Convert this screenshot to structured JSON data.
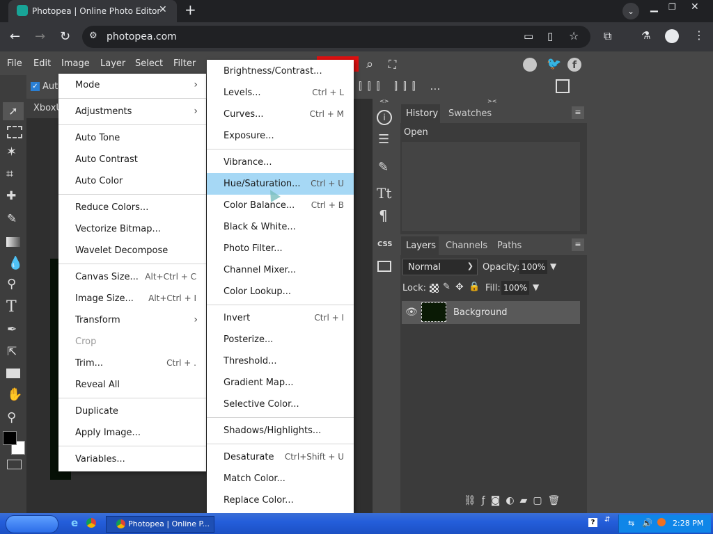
{
  "browser": {
    "tab_title": "Photopea | Online Photo Editor",
    "url": "photopea.com"
  },
  "menubar": [
    "File",
    "Edit",
    "Image",
    "Layer",
    "Select",
    "Filter"
  ],
  "options": {
    "auto_select_label": "Auto"
  },
  "document_tab": "XboxU",
  "image_menu": [
    {
      "label": "Mode",
      "submenu": true
    },
    {
      "sep": true
    },
    {
      "label": "Adjustments",
      "submenu": true
    },
    {
      "sep": true
    },
    {
      "label": "Auto Tone"
    },
    {
      "label": "Auto Contrast"
    },
    {
      "label": "Auto Color"
    },
    {
      "sep": true
    },
    {
      "label": "Reduce Colors..."
    },
    {
      "label": "Vectorize Bitmap..."
    },
    {
      "label": "Wavelet Decompose"
    },
    {
      "sep": true
    },
    {
      "label": "Canvas Size...",
      "shortcut": "Alt+Ctrl + C"
    },
    {
      "label": "Image Size...",
      "shortcut": "Alt+Ctrl + I"
    },
    {
      "label": "Transform",
      "submenu": true
    },
    {
      "label": "Crop",
      "disabled": true
    },
    {
      "label": "Trim...",
      "shortcut": "Ctrl + ."
    },
    {
      "label": "Reveal All"
    },
    {
      "sep": true
    },
    {
      "label": "Duplicate"
    },
    {
      "label": "Apply Image..."
    },
    {
      "sep": true
    },
    {
      "label": "Variables..."
    }
  ],
  "adjustments_menu": [
    {
      "label": "Brightness/Contrast..."
    },
    {
      "label": "Levels...",
      "shortcut": "Ctrl + L"
    },
    {
      "label": "Curves...",
      "shortcut": "Ctrl + M"
    },
    {
      "label": "Exposure..."
    },
    {
      "sep": true
    },
    {
      "label": "Vibrance..."
    },
    {
      "label": "Hue/Saturation...",
      "shortcut": "Ctrl + U",
      "highlighted": true
    },
    {
      "label": "Color Balance...",
      "shortcut": "Ctrl + B"
    },
    {
      "label": "Black & White..."
    },
    {
      "label": "Photo Filter..."
    },
    {
      "label": "Channel Mixer..."
    },
    {
      "label": "Color Lookup..."
    },
    {
      "sep": true
    },
    {
      "label": "Invert",
      "shortcut": "Ctrl + I"
    },
    {
      "label": "Posterize..."
    },
    {
      "label": "Threshold..."
    },
    {
      "label": "Gradient Map..."
    },
    {
      "label": "Selective Color..."
    },
    {
      "sep": true
    },
    {
      "label": "Shadows/Highlights..."
    },
    {
      "sep": true
    },
    {
      "label": "Desaturate",
      "shortcut": "Ctrl+Shift + U"
    },
    {
      "label": "Match Color..."
    },
    {
      "label": "Replace Color..."
    }
  ],
  "history_panel": {
    "tabs": [
      "History",
      "Swatches"
    ],
    "items": [
      "Open"
    ]
  },
  "layers_panel": {
    "tabs": [
      "Layers",
      "Channels",
      "Paths"
    ],
    "blend_mode": "Normal",
    "opacity_label": "Opacity:",
    "opacity_value": "100%",
    "lock_label": "Lock:",
    "fill_label": "Fill:",
    "fill_value": "100%",
    "layers": [
      {
        "name": "Background"
      }
    ]
  },
  "side_labels": {
    "css": "CSS"
  },
  "taskbar": {
    "task_label": "Photopea | Online P...",
    "clock": "2:28 PM"
  },
  "colors": {
    "highlight": "#a6d8f5",
    "accent_red": "#e01010"
  }
}
